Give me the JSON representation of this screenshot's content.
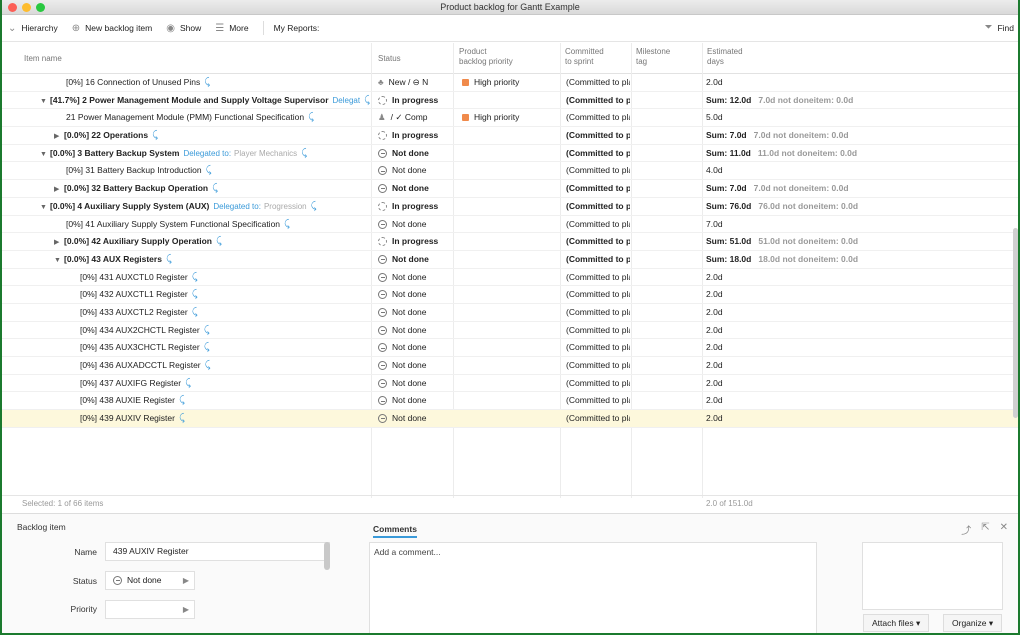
{
  "window": {
    "title": "Product backlog for Gantt Example"
  },
  "toolbar": {
    "hierarchy": "Hierarchy",
    "new_item": "New backlog item",
    "show": "Show",
    "more": "More",
    "my_reports": "My Reports:",
    "find": "Find"
  },
  "columns": {
    "item_name": "Item name",
    "status": "Status",
    "priority_1": "Product",
    "priority_2": "backlog priority",
    "sprint_1": "Committed",
    "sprint_2": "to sprint",
    "milestone_1": "Milestone",
    "milestone_2": "tag",
    "estimated_1": "Estimated",
    "estimated_2": "days"
  },
  "rows": [
    {
      "indent": 64,
      "tri": "",
      "bold": false,
      "name": "[0%] 16 Connection of Unused Pins",
      "delegate": "",
      "delegate_to": "",
      "status_icon": "new",
      "status": "New  /  ⊖  N",
      "priority": "High priority",
      "sprint": "(Committed to pla",
      "est": "2.0d",
      "est_extra": ""
    },
    {
      "indent": 38,
      "tri": "▼",
      "bold": true,
      "name": "[41.7%] 2 Power Management Module and Supply Voltage Supervisor",
      "delegate": "Delegat",
      "delegate_to": "",
      "status_icon": "inprog",
      "status": "In progress",
      "priority": "",
      "sprint": "(Committed to pla",
      "est": "Sum: 12.0d",
      "est_extra": "7.0d not doneitem: 0.0d"
    },
    {
      "indent": 64,
      "tri": "",
      "bold": false,
      "name": "21 Power Management Module (PMM) Functional Specification",
      "delegate": "",
      "delegate_to": "",
      "status_icon": "comp",
      "status": "/  ✓  Comp",
      "priority": "High priority",
      "sprint": "(Committed to pla",
      "est": "5.0d",
      "est_extra": ""
    },
    {
      "indent": 52,
      "tri": "▶",
      "bold": true,
      "name": "[0.0%] 22 Operations",
      "delegate": "",
      "delegate_to": "",
      "status_icon": "inprog",
      "status": "In progress",
      "priority": "",
      "sprint": "(Committed to pla",
      "est": "Sum: 7.0d",
      "est_extra": "7.0d not doneitem: 0.0d"
    },
    {
      "indent": 38,
      "tri": "▼",
      "bold": true,
      "name": "[0.0%] 3 Battery Backup System",
      "delegate": "Delegated to:",
      "delegate_to": "Player Mechanics",
      "status_icon": "notdone",
      "status": "Not done",
      "priority": "",
      "sprint": "(Committed to pla",
      "est": "Sum: 11.0d",
      "est_extra": "11.0d not doneitem: 0.0d"
    },
    {
      "indent": 64,
      "tri": "",
      "bold": false,
      "name": "[0%] 31 Battery Backup Introduction",
      "delegate": "",
      "delegate_to": "",
      "status_icon": "notdone",
      "status": "Not done",
      "priority": "",
      "sprint": "(Committed to pla",
      "est": "4.0d",
      "est_extra": ""
    },
    {
      "indent": 52,
      "tri": "▶",
      "bold": true,
      "name": "[0.0%] 32 Battery Backup Operation",
      "delegate": "",
      "delegate_to": "",
      "status_icon": "notdone",
      "status": "Not done",
      "priority": "",
      "sprint": "(Committed to pla",
      "est": "Sum: 7.0d",
      "est_extra": "7.0d not doneitem: 0.0d"
    },
    {
      "indent": 38,
      "tri": "▼",
      "bold": true,
      "name": "[0.0%] 4 Auxiliary Supply System (AUX)",
      "delegate": "Delegated to:",
      "delegate_to": "Progression",
      "status_icon": "inprog",
      "status": "In progress",
      "priority": "",
      "sprint": "(Committed to pla",
      "est": "Sum: 76.0d",
      "est_extra": "76.0d not doneitem: 0.0d"
    },
    {
      "indent": 64,
      "tri": "",
      "bold": false,
      "name": "[0%] 41 Auxiliary Supply System Functional Specification",
      "delegate": "",
      "delegate_to": "",
      "status_icon": "notdone",
      "status": "Not done",
      "priority": "",
      "sprint": "(Committed to pla",
      "est": "7.0d",
      "est_extra": ""
    },
    {
      "indent": 52,
      "tri": "▶",
      "bold": true,
      "name": "[0.0%] 42 Auxiliary Supply Operation",
      "delegate": "",
      "delegate_to": "",
      "status_icon": "inprog",
      "status": "In progress",
      "priority": "",
      "sprint": "(Committed to pla",
      "est": "Sum: 51.0d",
      "est_extra": "51.0d not doneitem: 0.0d"
    },
    {
      "indent": 52,
      "tri": "▼",
      "bold": true,
      "name": "[0.0%] 43 AUX Registers",
      "delegate": "",
      "delegate_to": "",
      "status_icon": "notdone",
      "status": "Not done",
      "priority": "",
      "sprint": "(Committed to pla",
      "est": "Sum: 18.0d",
      "est_extra": "18.0d not doneitem: 0.0d"
    },
    {
      "indent": 78,
      "tri": "",
      "bold": false,
      "name": "[0%] 431 AUXCTL0 Register",
      "delegate": "",
      "delegate_to": "",
      "status_icon": "notdone",
      "status": "Not done",
      "priority": "",
      "sprint": "(Committed to pla",
      "est": "2.0d",
      "est_extra": ""
    },
    {
      "indent": 78,
      "tri": "",
      "bold": false,
      "name": "[0%] 432 AUXCTL1 Register",
      "delegate": "",
      "delegate_to": "",
      "status_icon": "notdone",
      "status": "Not done",
      "priority": "",
      "sprint": "(Committed to pla",
      "est": "2.0d",
      "est_extra": ""
    },
    {
      "indent": 78,
      "tri": "",
      "bold": false,
      "name": "[0%] 433 AUXCTL2 Register",
      "delegate": "",
      "delegate_to": "",
      "status_icon": "notdone",
      "status": "Not done",
      "priority": "",
      "sprint": "(Committed to pla",
      "est": "2.0d",
      "est_extra": ""
    },
    {
      "indent": 78,
      "tri": "",
      "bold": false,
      "name": "[0%] 434 AUX2CHCTL Register",
      "delegate": "",
      "delegate_to": "",
      "status_icon": "notdone",
      "status": "Not done",
      "priority": "",
      "sprint": "(Committed to pla",
      "est": "2.0d",
      "est_extra": ""
    },
    {
      "indent": 78,
      "tri": "",
      "bold": false,
      "name": "[0%] 435 AUX3CHCTL Register",
      "delegate": "",
      "delegate_to": "",
      "status_icon": "notdone",
      "status": "Not done",
      "priority": "",
      "sprint": "(Committed to pla",
      "est": "2.0d",
      "est_extra": ""
    },
    {
      "indent": 78,
      "tri": "",
      "bold": false,
      "name": "[0%] 436 AUXADCCTL Register",
      "delegate": "",
      "delegate_to": "",
      "status_icon": "notdone",
      "status": "Not done",
      "priority": "",
      "sprint": "(Committed to pla",
      "est": "2.0d",
      "est_extra": ""
    },
    {
      "indent": 78,
      "tri": "",
      "bold": false,
      "name": "[0%] 437 AUXIFG Register",
      "delegate": "",
      "delegate_to": "",
      "status_icon": "notdone",
      "status": "Not done",
      "priority": "",
      "sprint": "(Committed to pla",
      "est": "2.0d",
      "est_extra": ""
    },
    {
      "indent": 78,
      "tri": "",
      "bold": false,
      "name": "[0%] 438 AUXIE Register",
      "delegate": "",
      "delegate_to": "",
      "status_icon": "notdone",
      "status": "Not done",
      "priority": "",
      "sprint": "(Committed to pla",
      "est": "2.0d",
      "est_extra": ""
    },
    {
      "indent": 78,
      "tri": "",
      "bold": false,
      "name": "[0%] 439 AUXIV Register",
      "delegate": "",
      "delegate_to": "",
      "status_icon": "notdone",
      "status": "Not done",
      "priority": "",
      "sprint": "(Committed to pla",
      "est": "2.0d",
      "est_extra": "",
      "selected": true
    }
  ],
  "footer": {
    "selected": "Selected: 1 of 66 items",
    "total": "2.0 of 151.0d"
  },
  "detail": {
    "section_title": "Backlog item",
    "name_label": "Name",
    "name_value": "439 AUXIV Register",
    "status_label": "Status",
    "status_value": "Not done",
    "priority_label": "Priority",
    "comments_tab": "Comments",
    "comment_placeholder": "Add a comment...",
    "attach_files": "Attach files",
    "organize": "Organize"
  },
  "colors": {
    "accent": "#3a9ad9",
    "priority_high": "#f08a4b",
    "selected_row": "#fdf8dc",
    "frame": "#1b7a2e"
  }
}
